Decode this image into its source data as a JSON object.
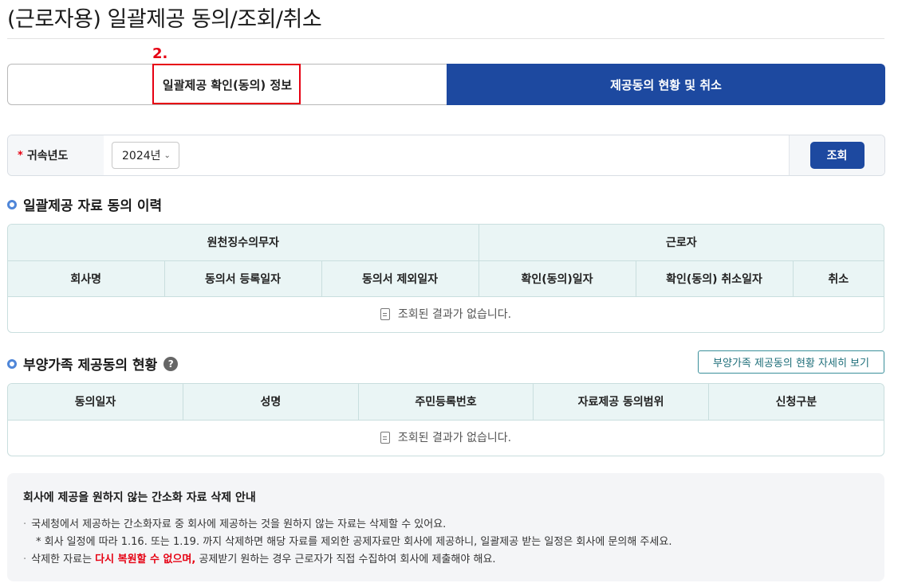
{
  "page": {
    "title": "(근로자용) 일괄제공 동의/조회/취소"
  },
  "annotation": {
    "number": "2."
  },
  "tabs": [
    {
      "label": "일괄제공 확인(동의) 정보",
      "active": false
    },
    {
      "label": "제공동의 현황 및 취소",
      "active": true
    }
  ],
  "filter": {
    "required_mark": "*",
    "label": "귀속년도",
    "year_value": "2024년",
    "search_button": "조회"
  },
  "section1": {
    "title": "일괄제공 자료 동의 이력",
    "group_headers": [
      "원천징수의무자",
      "근로자"
    ],
    "columns": [
      "회사명",
      "동의서 등록일자",
      "동의서 제외일자",
      "확인(동의)일자",
      "확인(동의) 취소일자",
      "취소"
    ],
    "empty_text": "조회된 결과가 없습니다."
  },
  "section2": {
    "title": "부양가족 제공동의 현황",
    "help_icon": "?",
    "detail_button": "부양가족 제공동의 현황 자세히 보기",
    "columns": [
      "동의일자",
      "성명",
      "주민등록번호",
      "자료제공 동의범위",
      "신청구분"
    ],
    "empty_text": "조회된 결과가 없습니다."
  },
  "notice": {
    "title": "회사에 제공을 원하지 않는 간소화 자료 삭제 안내",
    "line1": "국세청에서 제공하는 간소화자료 중 회사에 제공하는 것을 원하지 않는 자료는 삭제할 수 있어요.",
    "line2": "* 회사 일정에 따라 1.16. 또는 1.19. 까지 삭제하면 해당 자료를 제외한 공제자료만 회사에 제공하니, 일괄제공 받는 일정은 회사에 문의해 주세요.",
    "line3_pre": "삭제한 자료는 ",
    "line3_red": "다시 복원할 수 없으며,",
    "line3_post": " 공제받기 원하는 경우 근로자가 직접 수집하여 회사에 제출해야 해요.",
    "bullet": "·"
  },
  "colors": {
    "primary": "#1d49a0",
    "annotation": "#e60012",
    "table_header": "#eaf5f5"
  }
}
